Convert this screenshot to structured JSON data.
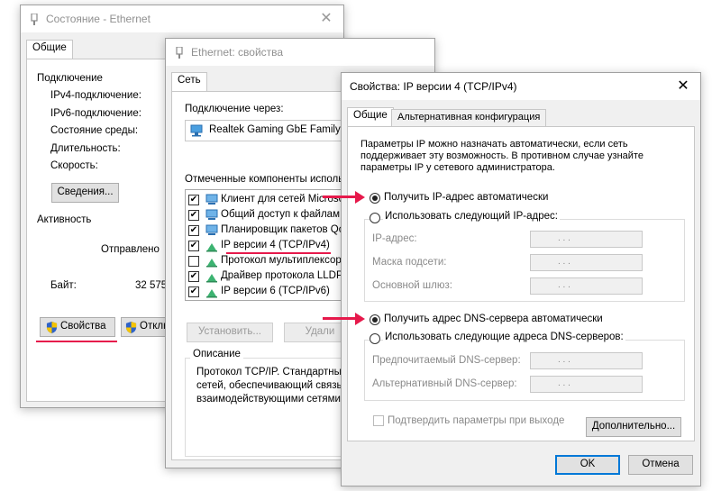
{
  "status_window": {
    "title": "Состояние - Ethernet",
    "tab": "Общие",
    "connection_label": "Подключение",
    "ipv4_label": "IPv4-подключение:",
    "ipv6_label": "IPv6-подключение:",
    "media_label": "Состояние среды:",
    "duration_label": "Длительность:",
    "speed_label": "Скорость:",
    "details_button": "Сведения...",
    "activity_label": "Активность",
    "sent_label": "Отправлено",
    "bytes_label": "Байт:",
    "bytes_value": "32 575",
    "properties_button": "Свойства",
    "disable_button": "Отклю"
  },
  "eth_props_window": {
    "title": "Ethernet: свойства",
    "tab": "Сеть",
    "connect_via_label": "Подключение через:",
    "adapter_name": "Realtek Gaming GbE Family C",
    "components_label": "Отмеченные компоненты использ",
    "components": [
      {
        "label": "Клиент для сетей Microsoft",
        "checked": true,
        "icon": "network-client-icon"
      },
      {
        "label": "Общий доступ к файлам и",
        "checked": true,
        "icon": "file-sharing-icon"
      },
      {
        "label": "Планировщик пакетов Qo",
        "checked": true,
        "icon": "packet-scheduler-icon"
      },
      {
        "label": "IP версии 4 (TCP/IPv4)",
        "checked": true,
        "icon": "protocol-icon"
      },
      {
        "label": "Протокол мультиплексор",
        "checked": false,
        "icon": "protocol-icon"
      },
      {
        "label": "Драйвер протокола LLDP",
        "checked": true,
        "icon": "protocol-icon"
      },
      {
        "label": "IP версии 6 (TCP/IPv6)",
        "checked": true,
        "icon": "protocol-icon"
      }
    ],
    "install_button": "Установить...",
    "remove_button": "Удали",
    "description_label": "Описание",
    "description_lines": [
      "Протокол TCP/IP. Стандартный",
      "сетей, обеспечивающий связь",
      "взаимодействующими сетями."
    ]
  },
  "ipv4_window": {
    "title": "Свойства: IP версии 4 (TCP/IPv4)",
    "tab_general": "Общие",
    "tab_alternate": "Альтернативная конфигурация",
    "intro_lines": [
      "Параметры IP можно назначать автоматически, если сеть",
      "поддерживает эту возможность. В противном случае узнайте",
      "параметры IP у сетевого администратора."
    ],
    "auto_ip_label": "Получить IP-адрес автоматически",
    "manual_ip_label": "Использовать следующий IP-адрес:",
    "ip_address_label": "IP-адрес:",
    "subnet_label": "Маска подсети:",
    "gateway_label": "Основной шлюз:",
    "auto_dns_label": "Получить адрес DNS-сервера автоматически",
    "manual_dns_label": "Использовать следующие адреса DNS-серверов:",
    "preferred_dns_label": "Предпочитаемый DNS-сервер:",
    "alternate_dns_label": "Альтернативный DNS-сервер:",
    "ip_dots": ".      .      .",
    "validate_label": "Подтвердить параметры при выходе",
    "advanced_button": "Дополнительно...",
    "ok_button": "OK",
    "cancel_button": "Отмена",
    "selected_ip_mode": "auto",
    "selected_dns_mode": "auto"
  },
  "colors": {
    "annotation": "#e6194b",
    "accent": "#0078d7"
  }
}
